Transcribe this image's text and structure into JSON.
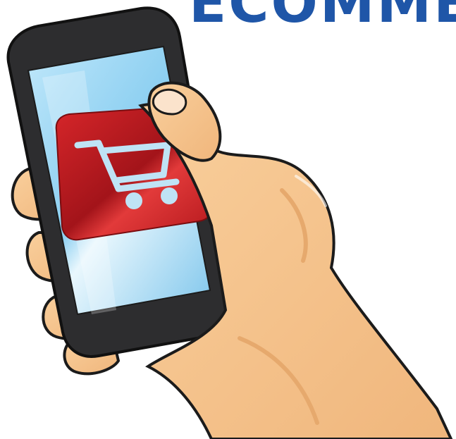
{
  "headline": {
    "text": "ECOMMER",
    "color": "#1f56a8"
  },
  "illustration": {
    "subject": "hand-holding-smartphone",
    "screen_icon": "shopping-cart-icon",
    "colors": {
      "skin": "#f6c48b",
      "skin_shadow": "#e6a96d",
      "outline": "#1b1b1b",
      "phone_body": "#2d2d2f",
      "screen_glass": "#9ad6f3",
      "app_tile": "#c41e1e",
      "cart_icon": "#bfe3f5",
      "headline_blue": "#1f56a8"
    }
  }
}
